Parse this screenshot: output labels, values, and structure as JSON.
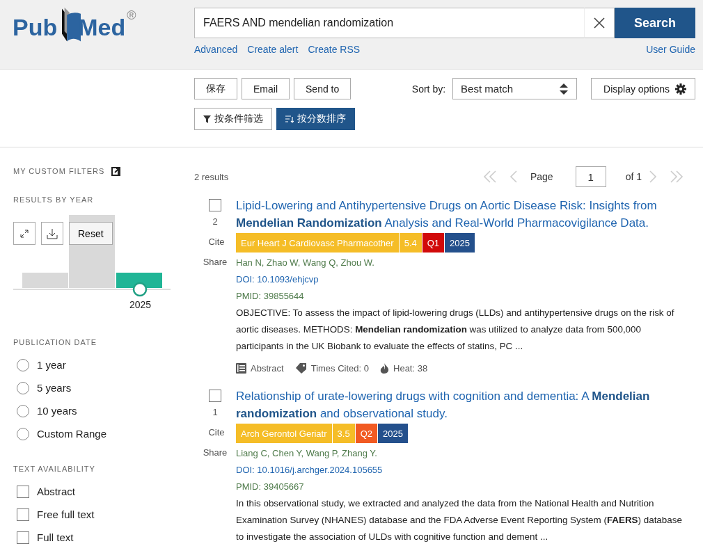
{
  "header": {
    "logo": {
      "left": "Pub",
      "right": "Med",
      "mark": "®"
    },
    "search": {
      "value": "FAERS AND mendelian randomization",
      "button": "Search"
    },
    "links": [
      "Advanced",
      "Create alert",
      "Create RSS"
    ],
    "guide": "User Guide"
  },
  "toolbar": {
    "buttons": [
      "保存",
      "Email",
      "Send to"
    ],
    "sort_label": "Sort by:",
    "sort_value": "Best match",
    "display": "Display options",
    "filter_button": "按条件筛选",
    "score_button": "按分数排序"
  },
  "sidebar": {
    "custom_filters": "MY CUSTOM FILTERS",
    "by_year": {
      "title": "RESULTS BY YEAR",
      "reset": "Reset",
      "year": "2025"
    },
    "pub_date": {
      "title": "PUBLICATION DATE",
      "options": [
        {
          "label": "1 year",
          "selected": false
        },
        {
          "label": "5 years",
          "selected": false
        },
        {
          "label": "10 years",
          "selected": false
        },
        {
          "label": "Custom Range",
          "selected": false
        }
      ]
    },
    "text_availability": {
      "title": "TEXT AVAILABILITY",
      "options": [
        {
          "label": "Abstract",
          "checked": false
        },
        {
          "label": "Free full text",
          "checked": false
        },
        {
          "label": "Full text",
          "checked": false
        }
      ]
    }
  },
  "results": {
    "count": "2 results",
    "page_label": "Page",
    "page": "1",
    "of": "of 1",
    "articles": [
      {
        "checked": false,
        "number": "2",
        "cite": "Cite",
        "share": "Share",
        "title": "Lipid-Lowering and Antihypertensive Drugs on Aortic Disease Risk: Insights from **Mendelian Randomization** Analysis and Real-World Pharmacovigilance Data.",
        "badges": [
          {
            "text": "Eur Heart J Cardiovasc Pharmacother",
            "color": "#f5bd27"
          },
          {
            "text": "5.4",
            "color": "#f5bd27"
          },
          {
            "text": "Q1",
            "color": "#d10a0a"
          },
          {
            "text": "2025",
            "color": "#24508c"
          }
        ],
        "authors": "Han N, Zhao W, Wang Q, Zhou W.",
        "doi": "DOI: 10.1093/ehjcvp",
        "pmid": "PMID: 39855644",
        "abstract": "OBJECTIVE: To assess the impact of lipid-lowering drugs (LLDs) and antihypertensive drugs on the risk of aortic diseases. METHODS: **Mendelian randomization** was utilized to analyze data from 500,000 participants in the UK Biobank to evaluate the effects of statins, PC ...",
        "meta": {
          "abstract": "Abstract",
          "cited": "Times Cited: 0",
          "heat": "Heat: 38"
        }
      },
      {
        "checked": false,
        "number": "1",
        "cite": "Cite",
        "share": "Share",
        "title": "Relationship of urate-lowering drugs with cognition and dementia: A **Mendelian randomization** and observational study.",
        "badges": [
          {
            "text": "Arch Gerontol Geriatr",
            "color": "#f5bd27"
          },
          {
            "text": "3.5",
            "color": "#f5bd27"
          },
          {
            "text": "Q2",
            "color": "#f15a22"
          },
          {
            "text": "2025",
            "color": "#24508c"
          }
        ],
        "authors": "Liang C, Chen Y, Wang P, Zhang Y.",
        "doi": "DOI: 10.1016/j.archger.2024.105655",
        "pmid": "PMID: 39405667",
        "abstract": "In this observational study, we extracted and analyzed the data from the National Health and Nutrition Examination Survey (NHANES) database and the FDA Adverse Event Reporting System (**FAERS**) database to investigate the association of ULDs with cognitive function and dement ..."
      }
    ]
  }
}
